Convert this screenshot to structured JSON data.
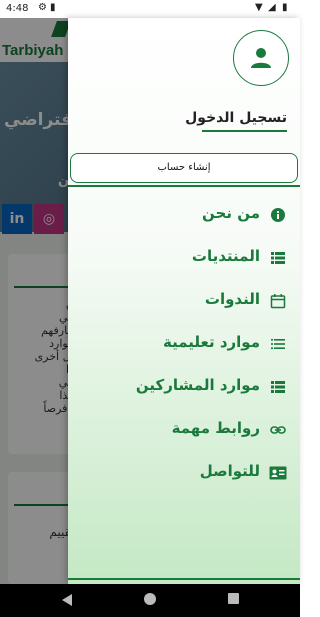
{
  "status_bar": {
    "time": "4:48",
    "icons": [
      "settings-icon",
      "sd-card-icon",
      "wifi-icon",
      "signal-icon",
      "battery-icon"
    ]
  },
  "background_app": {
    "brand": "Tarbiyah",
    "hero_title": "افتراضي",
    "hero_sub": "ن",
    "social": [
      {
        "name": "linkedin-icon",
        "glyph": "in",
        "color": "#0a66c2"
      },
      {
        "name": "instagram-icon",
        "glyph": "◎",
        "color": "#c13584"
      }
    ],
    "card1_lines": [
      "ن",
      "هي",
      "عارفهم",
      "موارد",
      "يل أخرى",
      "ذا",
      "اتي",
      "هذا",
      "أ فرصاً"
    ],
    "card2_text": "نقييم"
  },
  "drawer": {
    "login_label": "تسجيل الدخول",
    "create_account_label": "إنشاء حساب",
    "menu": [
      {
        "id": "about",
        "label": "من نحن",
        "icon": "info-icon"
      },
      {
        "id": "forums",
        "label": "المنتديات",
        "icon": "list-icon"
      },
      {
        "id": "seminars",
        "label": "الندوات",
        "icon": "calendar-icon"
      },
      {
        "id": "resources",
        "label": "موارد تعليمية",
        "icon": "lines-icon"
      },
      {
        "id": "participants",
        "label": "موارد المشاركين",
        "icon": "list-icon"
      },
      {
        "id": "links",
        "label": "روابط مهمة",
        "icon": "link-icon"
      },
      {
        "id": "contact",
        "label": "للتواصل",
        "icon": "contact-card-icon"
      }
    ]
  },
  "colors": {
    "accent": "#1a7a3c"
  }
}
